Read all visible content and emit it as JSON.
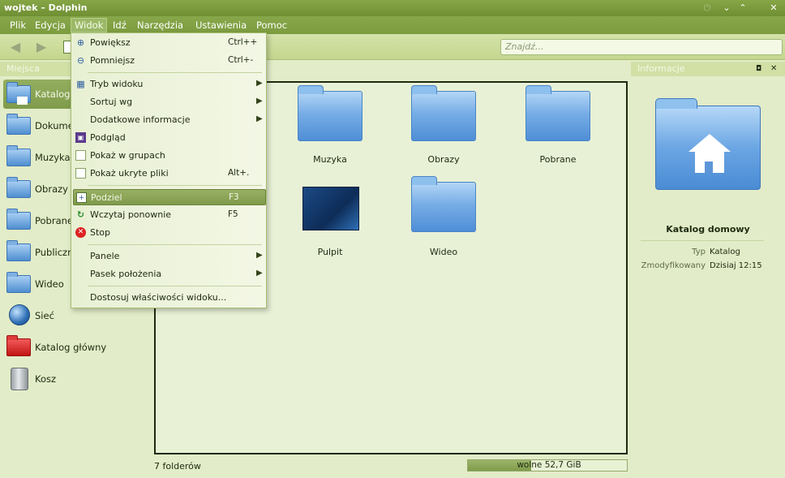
{
  "window": {
    "title": "wojtek – Dolphin"
  },
  "menubar": [
    "Plik",
    "Edycja",
    "Widok",
    "Idź",
    "Narzędzia",
    "Ustawienia",
    "Pomoc"
  ],
  "search": {
    "placeholder": "Znajdź..."
  },
  "places": {
    "title": "Miejsca",
    "items": [
      {
        "label": "Katalog"
      },
      {
        "label": "Dokume"
      },
      {
        "label": "Muzyka"
      },
      {
        "label": "Obrazy"
      },
      {
        "label": "Pobrane"
      },
      {
        "label": "Publiczn"
      },
      {
        "label": "Wideo"
      },
      {
        "label": "Sieć"
      },
      {
        "label": "Katalog główny"
      },
      {
        "label": "Kosz"
      }
    ]
  },
  "menu": {
    "items": [
      {
        "label": "Powiększ",
        "shortcut": "Ctrl++"
      },
      {
        "label": "Pomniejsz",
        "shortcut": "Ctrl+-"
      },
      {
        "label": "Tryb widoku"
      },
      {
        "label": "Sortuj wg"
      },
      {
        "label": "Dodatkowe informacje"
      },
      {
        "label": "Podgląd"
      },
      {
        "label": "Pokaż w grupach"
      },
      {
        "label": "Pokaż ukryte pliki",
        "shortcut": "Alt+."
      },
      {
        "label": "Podziel",
        "shortcut": "F3"
      },
      {
        "label": "Wczytaj ponownie",
        "shortcut": "F5"
      },
      {
        "label": "Stop"
      },
      {
        "label": "Panele"
      },
      {
        "label": "Pasek położenia"
      },
      {
        "label": "Dostosuj właściwości widoku..."
      }
    ]
  },
  "files": [
    {
      "label": "Muzyka"
    },
    {
      "label": "Obrazy"
    },
    {
      "label": "Pobrane"
    },
    {
      "label": "Pulpit"
    },
    {
      "label": "Wideo"
    }
  ],
  "info": {
    "title": "Informacje",
    "name": "Katalog domowy",
    "type_label": "Typ",
    "type_value": "Katalog",
    "modified_label": "Zmodyfikowany",
    "modified_value": "Dzisiaj 12:15"
  },
  "status": {
    "count": "7 folderów",
    "capacity_text": "wolne 52,7 GiB",
    "capacity_used_fraction": 0.4
  }
}
